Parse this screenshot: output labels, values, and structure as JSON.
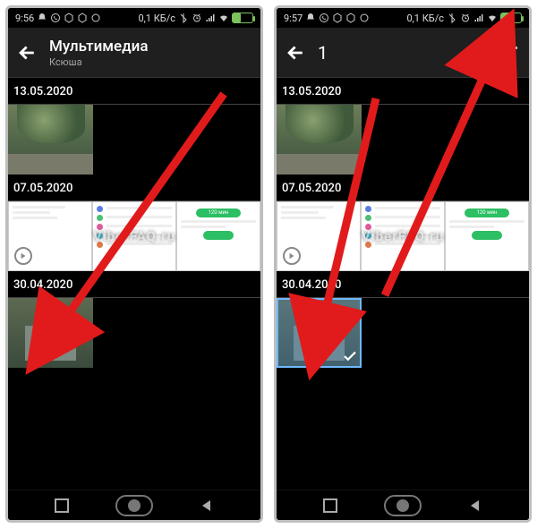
{
  "left": {
    "status": {
      "time": "9:56",
      "dataRate": "0,1 КБ/с",
      "battery": "37"
    },
    "header": {
      "title": "Мультимедиа",
      "subtitle": "Ксюша"
    },
    "groups": [
      {
        "date": "13.05.2020"
      },
      {
        "date": "07.05.2020",
        "cardTime": "120 мин"
      },
      {
        "date": "30.04.2020"
      }
    ],
    "watermark": "ViberFAQ.ru"
  },
  "right": {
    "status": {
      "time": "9:57",
      "dataRate": "0,1 КБ/с",
      "battery": "37"
    },
    "header": {
      "selectedCount": "1"
    },
    "groups": [
      {
        "date": "13.05.2020"
      },
      {
        "date": "07.05.2020",
        "cardTime": "120 мин"
      },
      {
        "date": "30.04.2020"
      }
    ],
    "watermark": "ViberFAQ.ru"
  },
  "arrowColor": "#e11b1b"
}
